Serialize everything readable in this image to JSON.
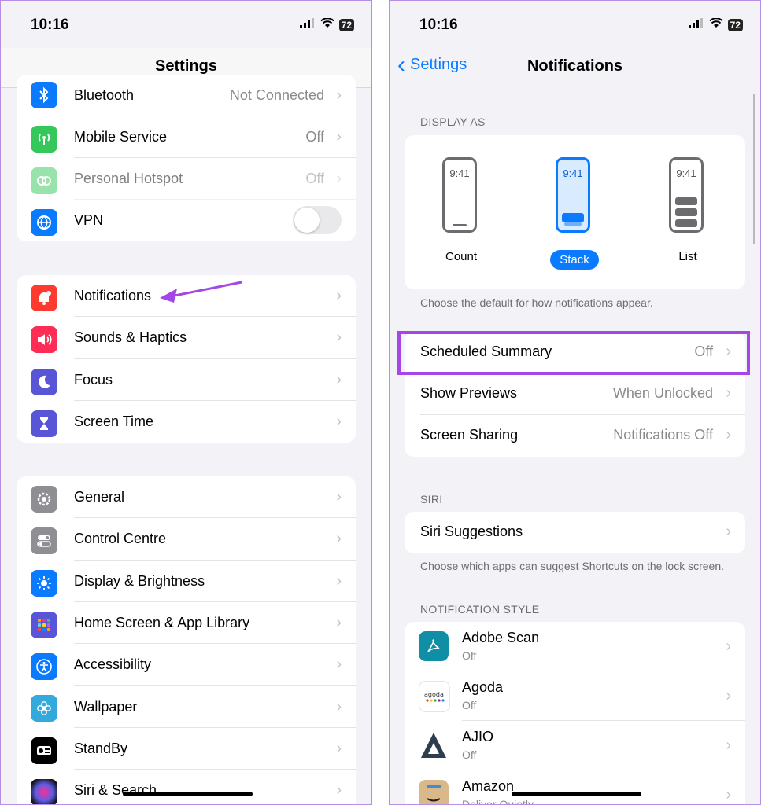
{
  "status": {
    "time": "10:16",
    "battery": "72"
  },
  "left": {
    "title": "Settings",
    "group1": [
      {
        "label": "Bluetooth",
        "value": "Not Connected",
        "icon": "bluetooth-icon",
        "color": "#0a7aff"
      },
      {
        "label": "Mobile Service",
        "value": "Off",
        "icon": "antenna-icon",
        "color": "#34c759"
      },
      {
        "label": "Personal Hotspot",
        "value": "Off",
        "icon": "hotspot-icon",
        "color": "#34c759"
      },
      {
        "label": "VPN",
        "value": "",
        "icon": "globe-icon",
        "color": "#0a7aff"
      }
    ],
    "group2": [
      {
        "label": "Notifications",
        "icon": "bell-icon",
        "color": "#ff3b30"
      },
      {
        "label": "Sounds & Haptics",
        "icon": "speaker-icon",
        "color": "#ff2d55"
      },
      {
        "label": "Focus",
        "icon": "moon-icon",
        "color": "#5856d6"
      },
      {
        "label": "Screen Time",
        "icon": "hourglass-icon",
        "color": "#5856d6"
      }
    ],
    "group3": [
      {
        "label": "General",
        "icon": "gear-icon",
        "color": "#8e8e93"
      },
      {
        "label": "Control Centre",
        "icon": "switches-icon",
        "color": "#8e8e93"
      },
      {
        "label": "Display & Brightness",
        "icon": "sun-icon",
        "color": "#0a7aff"
      },
      {
        "label": "Home Screen & App Library",
        "icon": "grid-icon",
        "color": "#5856d6"
      },
      {
        "label": "Accessibility",
        "icon": "accessibility-icon",
        "color": "#0a7aff"
      },
      {
        "label": "Wallpaper",
        "icon": "flower-icon",
        "color": "#34aadc"
      },
      {
        "label": "StandBy",
        "icon": "standby-icon",
        "color": "#000000"
      },
      {
        "label": "Siri & Search",
        "icon": "siri-icon",
        "color": "#222222"
      }
    ]
  },
  "right": {
    "back_label": "Settings",
    "title": "Notifications",
    "display_as_header": "DISPLAY AS",
    "display_options": [
      {
        "label": "Count",
        "time": "9:41"
      },
      {
        "label": "Stack",
        "time": "9:41"
      },
      {
        "label": "List",
        "time": "9:41"
      }
    ],
    "selected_display": "Stack",
    "display_footer": "Choose the default for how notifications appear.",
    "settings_rows": [
      {
        "label": "Scheduled Summary",
        "value": "Off"
      },
      {
        "label": "Show Previews",
        "value": "When Unlocked"
      },
      {
        "label": "Screen Sharing",
        "value": "Notifications Off"
      }
    ],
    "siri_header": "SIRI",
    "siri_row": "Siri Suggestions",
    "siri_footer": "Choose which apps can suggest Shortcuts on the lock screen.",
    "style_header": "NOTIFICATION STYLE",
    "apps": [
      {
        "name": "Adobe Scan",
        "sub": "Off",
        "icon": "adobe-scan-icon",
        "color": "#0f8ea6"
      },
      {
        "name": "Agoda",
        "sub": "Off",
        "icon": "agoda-icon",
        "color": "#ffffff"
      },
      {
        "name": "AJIO",
        "sub": "Off",
        "icon": "ajio-icon",
        "color": "#2c3e50"
      },
      {
        "name": "Amazon",
        "sub": "Deliver Quietly",
        "icon": "amazon-icon",
        "color": "#d9b98a"
      }
    ]
  }
}
